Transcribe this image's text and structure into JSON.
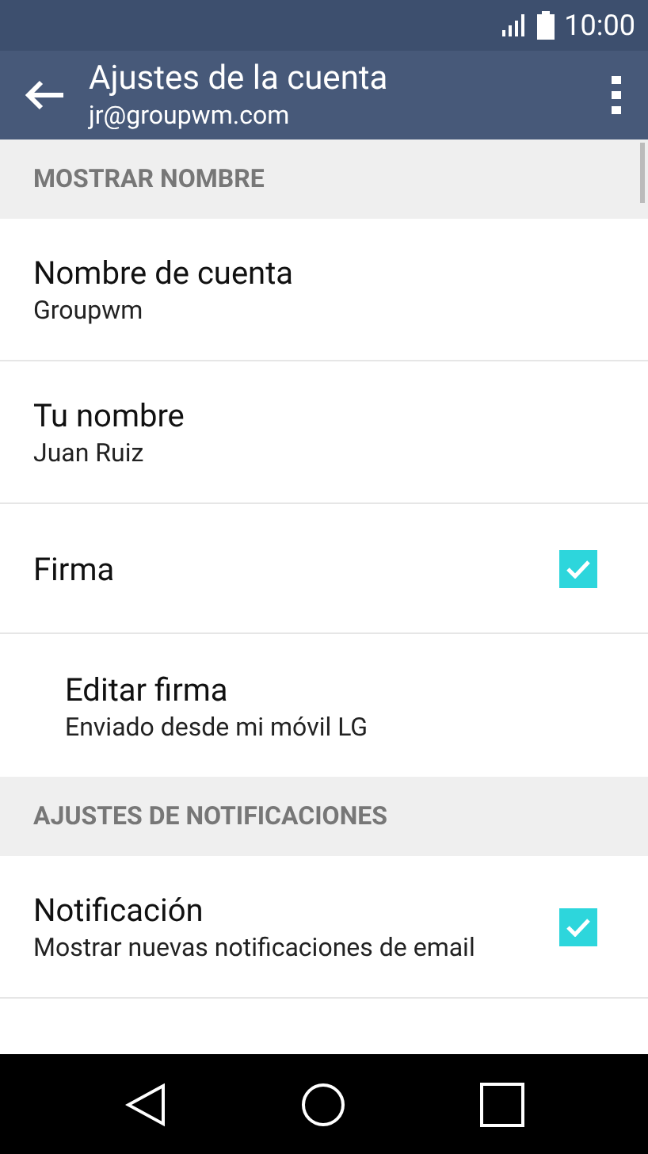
{
  "status_bar": {
    "time": "10:00"
  },
  "app_bar": {
    "title": "Ajustes de la cuenta",
    "subtitle": "jr@groupwm.com"
  },
  "list": [
    {
      "kind": "header",
      "title": "MOSTRAR NOMBRE"
    },
    {
      "kind": "item",
      "title": "Nombre de cuenta",
      "summary": "Groupwm"
    },
    {
      "kind": "item",
      "title": "Tu nombre",
      "summary": "Juan Ruiz"
    },
    {
      "kind": "checkbox",
      "title": "Firma",
      "checked": true
    },
    {
      "kind": "subitem",
      "title": "Editar firma",
      "summary": "Enviado desde mi móvil LG"
    },
    {
      "kind": "header",
      "title": "AJUSTES DE NOTIFICACIONES"
    },
    {
      "kind": "checkbox",
      "title": "Notificación",
      "summary": "Mostrar nuevas notificaciones de email",
      "checked": true
    }
  ]
}
